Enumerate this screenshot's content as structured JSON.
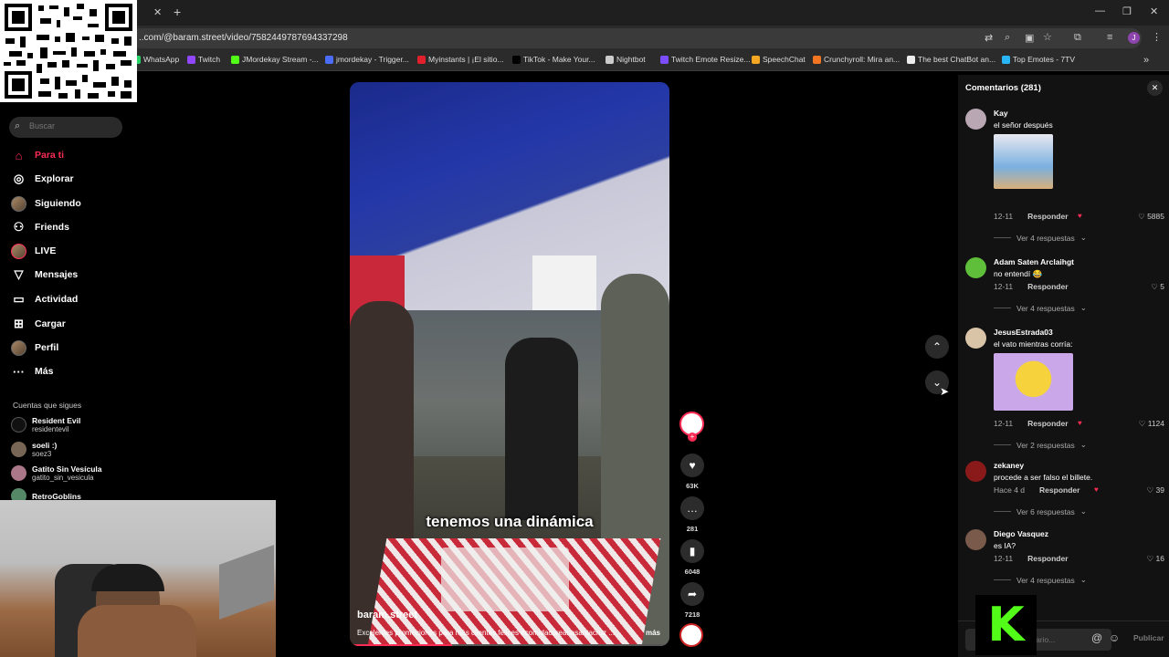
{
  "browser": {
    "url": "..com/@baram.street/video/7582449787694337298",
    "bookmarks": [
      {
        "label": "WhatsApp",
        "color": "#25d366"
      },
      {
        "label": "Twitch",
        "color": "#9146ff"
      },
      {
        "label": "JMordekay Stream -...",
        "color": "#53fc18"
      },
      {
        "label": "jmordekay - Trigger...",
        "color": "#4a6cf7"
      },
      {
        "label": "Myinstants | ¡El sitio...",
        "color": "#e0202a"
      },
      {
        "label": "TikTok - Make Your...",
        "color": "#000000"
      },
      {
        "label": "Nightbot",
        "color": "#cccccc"
      },
      {
        "label": "Twitch Emote Resize...",
        "color": "#7c4dff"
      },
      {
        "label": "SpeechChat",
        "color": "#f5a623"
      },
      {
        "label": "Crunchyroll: Mira an...",
        "color": "#f47521"
      },
      {
        "label": "The best ChatBot an...",
        "color": "#eeeeee"
      },
      {
        "label": "Top Emotes - 7TV",
        "color": "#29b6f6"
      }
    ]
  },
  "sidebar": {
    "search_placeholder": "Buscar",
    "nav": [
      {
        "label": "Para ti",
        "icon": "home-icon",
        "glyph": "⌂"
      },
      {
        "label": "Explorar",
        "icon": "compass-icon",
        "glyph": "◎"
      },
      {
        "label": "Siguiendo",
        "icon": "following-icon",
        "glyph": "●"
      },
      {
        "label": "Friends",
        "icon": "friends-icon",
        "glyph": "⚇"
      },
      {
        "label": "LIVE",
        "icon": "live-icon",
        "glyph": "●"
      },
      {
        "label": "Mensajes",
        "icon": "messages-icon",
        "glyph": "▽"
      },
      {
        "label": "Actividad",
        "icon": "activity-icon",
        "glyph": "▭"
      },
      {
        "label": "Cargar",
        "icon": "upload-icon",
        "glyph": "⊞"
      },
      {
        "label": "Perfil",
        "icon": "profile-icon",
        "glyph": "●"
      },
      {
        "label": "Más",
        "icon": "more-icon",
        "glyph": "···"
      }
    ],
    "following_title": "Cuentas que sigues",
    "following": [
      {
        "name": "Resident Evil",
        "handle": "residentevil"
      },
      {
        "name": "soeli :)",
        "handle": "soez3"
      },
      {
        "name": "Gatito Sin Vesícula",
        "handle": "gatito_sin_vesicula"
      },
      {
        "name": "RetroGoblins",
        "handle": ""
      }
    ]
  },
  "video": {
    "caption_overlay": "tenemos una dinámica",
    "author": "baram.street",
    "description": "Excelentes promociones para más clientes felices #comidacoreanasantacruz ...",
    "more": "más",
    "progress": 0.32
  },
  "actions": {
    "likes": "63K",
    "comments": "281",
    "saves": "6048",
    "shares": "7218"
  },
  "comments_panel": {
    "title": "Comentarios (281)",
    "comments": [
      {
        "user": "Kay",
        "text": "el señor después",
        "date": "12-11",
        "reply": "Responder",
        "likes": "5885",
        "replies": "Ver 4 respuestas"
      },
      {
        "user": "Adam Saten Arclaihgt",
        "text": "no entendí 😂",
        "date": "12-11",
        "reply": "Responder",
        "likes": "5",
        "replies": "Ver 4 respuestas"
      },
      {
        "user": "JesusEstrada03",
        "text": "el vato mientras corría:",
        "date": "12-11",
        "reply": "Responder",
        "likes": "1124",
        "replies": "Ver 2 respuestas"
      },
      {
        "user": "zekaney",
        "text": "procede a ser falso el billete.",
        "date": "Hace 4 d",
        "reply": "Responder",
        "likes": "39",
        "replies": "Ver 6 respuestas"
      },
      {
        "user": "Diego Vasquez",
        "text": "es IA?",
        "date": "12-11",
        "reply": "Responder",
        "likes": "16",
        "replies": "Ver 4 respuestas"
      }
    ],
    "input_placeholder": "...ario...",
    "publish": "Publicar"
  }
}
